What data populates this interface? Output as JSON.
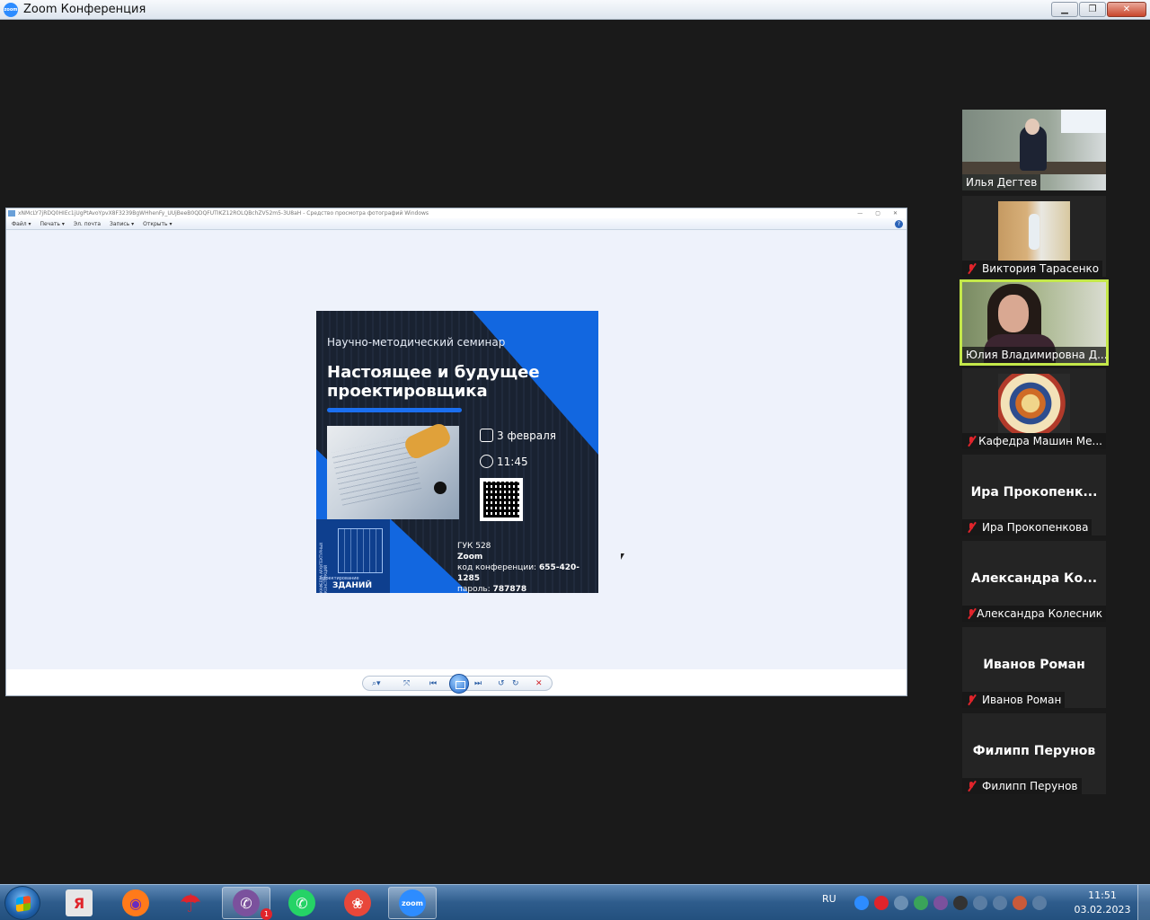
{
  "window": {
    "title": "Zoom Конференция",
    "controls": {
      "minimize": "▁",
      "restore": "❐",
      "close": "✕"
    },
    "logo_text": "zoom"
  },
  "viewer": {
    "title": "xNMcLY7jRDQ0HIEc1jUgPtAvoYpvX8F3239BgWHhenFy_UUjBeeB0QDQFUTIKZ12ROLQBchZV52m5-3U8aH - Средство просмотра фотографий Windows",
    "title_controls": [
      "—",
      "▢",
      "✕"
    ],
    "menu": [
      "Файл ▾",
      "Печать ▾",
      "Эл. почта",
      "Запись ▾",
      "Открыть ▾"
    ],
    "help": "?",
    "toolbar_icons": {
      "zoom": "⌕▾",
      "fit": "⤧",
      "prev": "⏮",
      "next": "⏭",
      "rotate_left": "↺",
      "rotate_right": "↻",
      "delete": "✕"
    }
  },
  "poster": {
    "subtitle": "Научно-методический семинар",
    "title": "Настоящее и будущее проектировщика",
    "date": "3 февраля",
    "time": "11:45",
    "venue_room": "ГУК 528",
    "venue_platform": "Zoom",
    "conf_code_label": "код конференции:",
    "conf_code": "655-420-1285",
    "password_label": "пароль:",
    "password": "787878",
    "dept_small": "проектирование",
    "dept_label": "ЗДАНИЙ",
    "dept_side": "КАФЕДРА АРХИТЕКТУРНЫХ КОНСТРУКЦИЙ"
  },
  "participants": [
    {
      "name": "Илья Дегтев",
      "muted": false,
      "video": true
    },
    {
      "name": "Виктория Тарасенко",
      "muted": true,
      "video": true
    },
    {
      "name": "Юлия Владимировна Д...",
      "muted": false,
      "video": true,
      "active": true
    },
    {
      "name": "Кафедра Машин Ме...",
      "muted": true,
      "video": true
    },
    {
      "name": "Ира Прокопенкова",
      "display": "Ира  Прокопенк...",
      "muted": true,
      "video": false
    },
    {
      "name": "Александра Колесник",
      "display": "Александра  Ко...",
      "muted": true,
      "video": false
    },
    {
      "name": "Иванов Роман",
      "display": "Иванов Роман",
      "muted": true,
      "video": false
    },
    {
      "name": "Филипп Перунов",
      "display": "Филипп Перунов",
      "muted": true,
      "video": false
    }
  ],
  "taskbar": {
    "apps": [
      {
        "name": "yandex-browser",
        "glyph": "Я",
        "color": "#e6e6e6",
        "fg": "#e0242b"
      },
      {
        "name": "firefox",
        "glyph": "◉",
        "color": "#ff7a1a",
        "fg": "#6a2bbf"
      },
      {
        "name": "umbrella",
        "glyph": "☂",
        "color": "transparent",
        "fg": "#e0242b"
      },
      {
        "name": "viber",
        "glyph": "✆",
        "color": "#7b519d",
        "fg": "#ffffff",
        "badge": "1"
      },
      {
        "name": "whatsapp",
        "glyph": "✆",
        "color": "#25d366",
        "fg": "#ffffff"
      },
      {
        "name": "screenshot-tool",
        "glyph": "❀",
        "color": "#e8473a",
        "fg": "#ffffff"
      },
      {
        "name": "zoom",
        "glyph": "zoom",
        "color": "#2d8cff",
        "fg": "#ffffff"
      }
    ],
    "language": "RU",
    "time": "11:51",
    "date": "03.02.2023"
  }
}
